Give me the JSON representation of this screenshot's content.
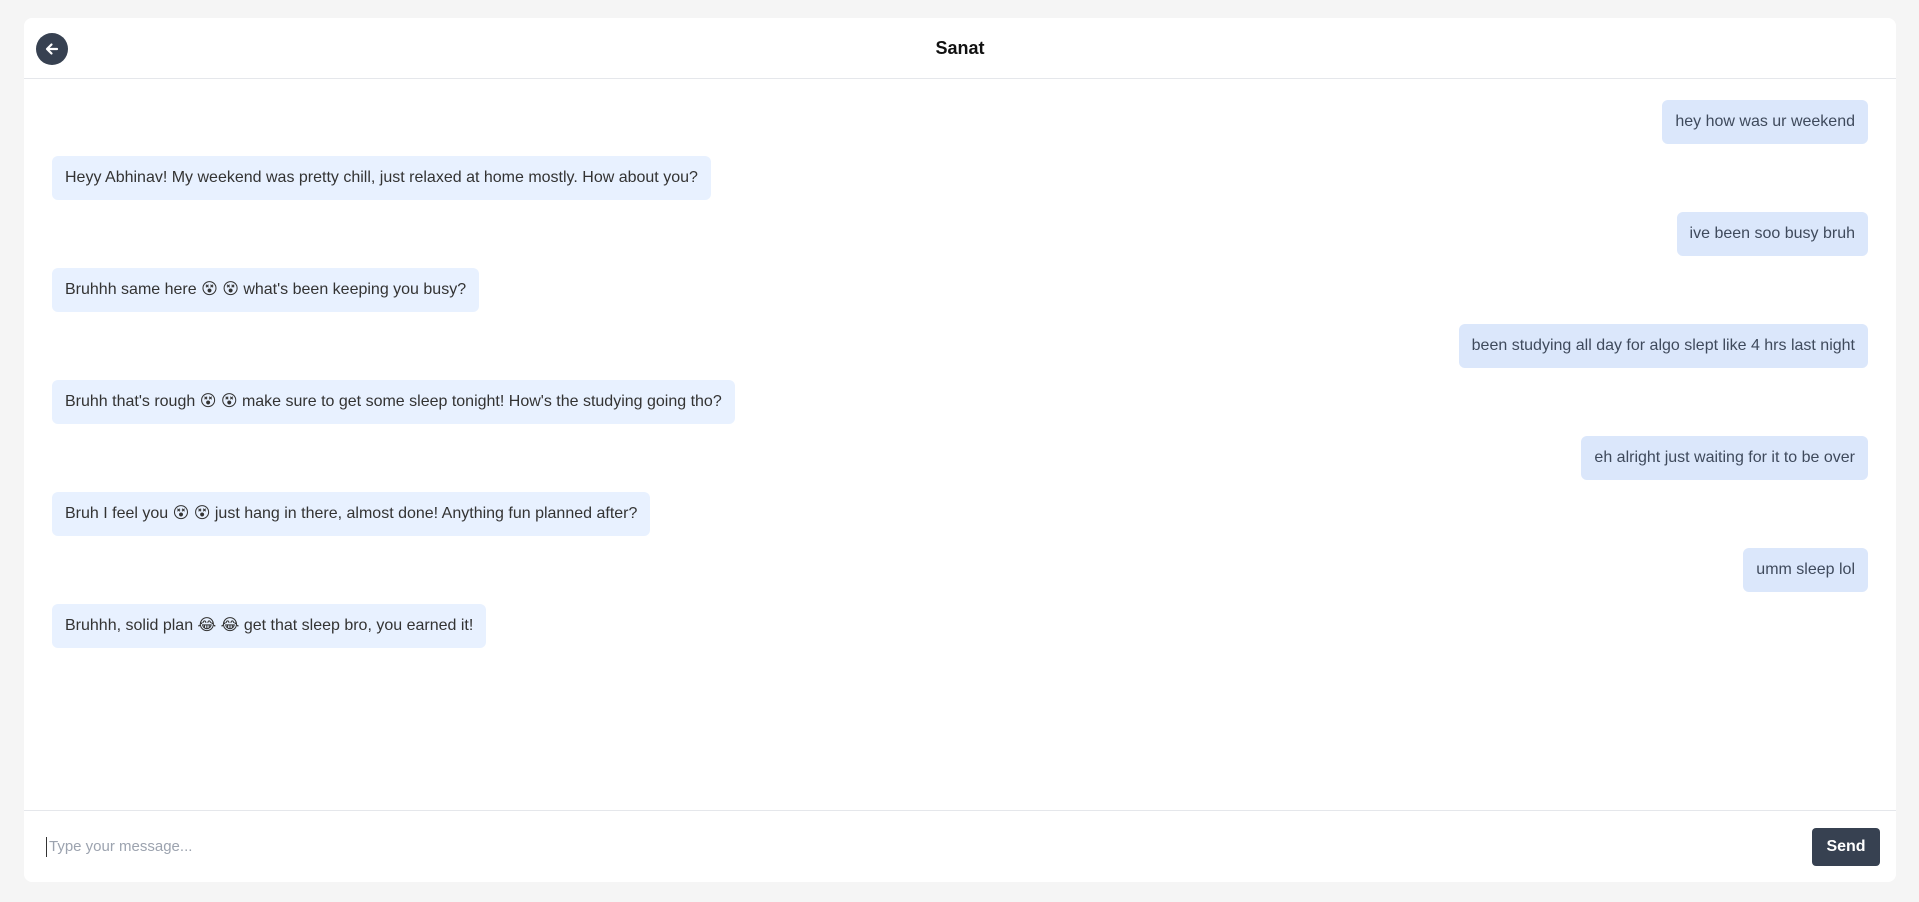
{
  "header": {
    "title": "Sanat",
    "back_icon": "arrow-left-icon"
  },
  "messages": [
    {
      "side": "sent",
      "text": "hey how was ur weekend"
    },
    {
      "side": "received",
      "text": "Heyy Abhinav! My weekend was pretty chill, just relaxed at home mostly. How about you?"
    },
    {
      "side": "sent",
      "text": "ive been soo busy bruh"
    },
    {
      "side": "received",
      "text": "Bruhhh same here 😵 😵 what's been keeping you busy?"
    },
    {
      "side": "sent",
      "text": "been studying all day for algo slept like 4 hrs last night"
    },
    {
      "side": "received",
      "text": "Bruhh that's rough 😵 😵 make sure to get some sleep tonight! How's the studying going tho?"
    },
    {
      "side": "sent",
      "text": "eh alright just waiting for it to be over"
    },
    {
      "side": "received",
      "text": "Bruh I feel you 😵 😵 just hang in there, almost done! Anything fun planned after?"
    },
    {
      "side": "sent",
      "text": "umm sleep lol"
    },
    {
      "side": "received",
      "text": "Bruhhh, solid plan 😂 😂 get that sleep bro, you earned it!"
    }
  ],
  "composer": {
    "placeholder": "Type your message...",
    "value": "",
    "send_label": "Send"
  },
  "colors": {
    "accent": "#374151",
    "sent_bubble": "#dbe7fb",
    "received_bubble": "#e8f1ff"
  }
}
